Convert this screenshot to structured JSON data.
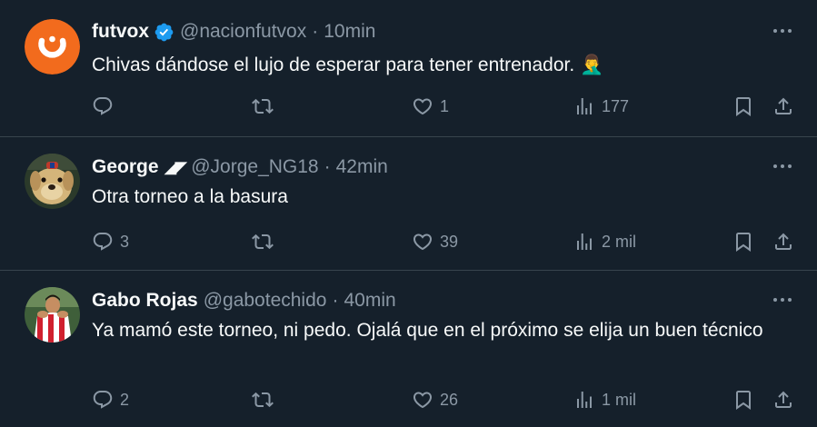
{
  "tweets": [
    {
      "display_name": "futvox",
      "verified": true,
      "name_emoji": "",
      "handle": "@nacionfutvox",
      "separator": "·",
      "time": "10min",
      "text": "Chivas dándose el lujo de esperar para tener entrenador. 🤦‍♂️",
      "replies": "",
      "retweets": "",
      "likes": "1",
      "views": "177",
      "avatar": "futvox-logo",
      "avatar_color": "#f26b1d"
    },
    {
      "display_name": "George",
      "verified": false,
      "name_emoji": "◢◤",
      "handle": "@Jorge_NG18",
      "separator": "·",
      "time": "42min",
      "text": "Otra torneo a la basura",
      "replies": "3",
      "retweets": "",
      "likes": "39",
      "views": "2 mil",
      "avatar": "dog-photo"
    },
    {
      "display_name": "Gabo Rojas",
      "verified": false,
      "name_emoji": "",
      "handle": "@gabotechido",
      "separator": "·",
      "time": "40min",
      "text": "Ya mamó este torneo, ni pedo. Ojalá que en el próximo se elija un buen técnico",
      "replies": "2",
      "retweets": "",
      "likes": "26",
      "views": "1 mil",
      "avatar": "player-photo"
    }
  ],
  "icons": {
    "reply": "reply-icon",
    "retweet": "retweet-icon",
    "like": "heart-icon",
    "views": "views-icon",
    "bookmark": "bookmark-icon",
    "share": "share-icon",
    "more": "more-icon",
    "verified": "verified-badge-icon"
  },
  "colors": {
    "background": "#15202b",
    "text": "#f7f9f9",
    "secondary": "#8b98a5",
    "divider": "#38444d",
    "verified": "#1d9bf0"
  }
}
